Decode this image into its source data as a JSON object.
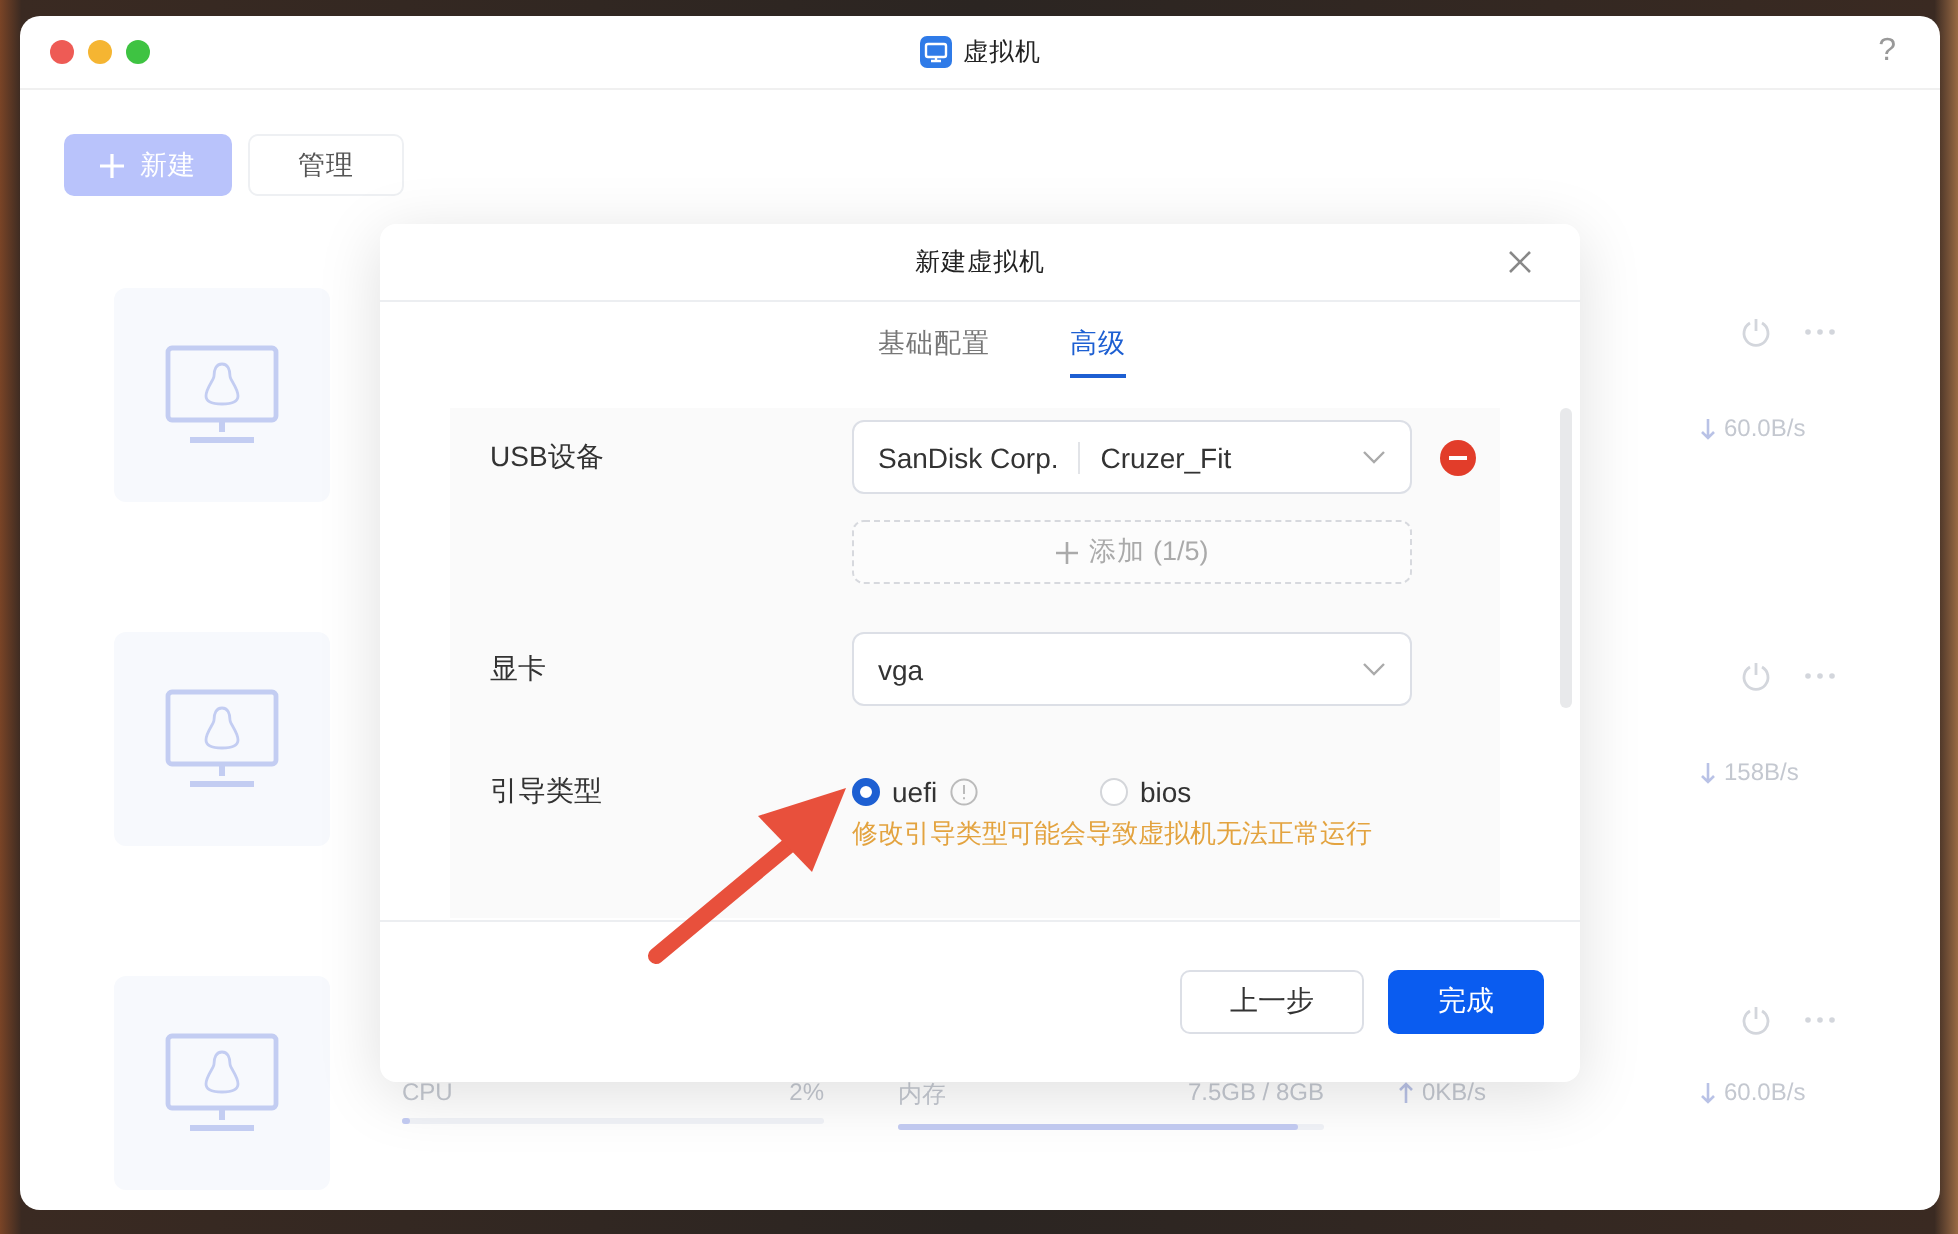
{
  "window": {
    "title": "虚拟机",
    "help": "?"
  },
  "toolbar": [
    {
      "label": "新建",
      "kind": "primary",
      "disabled": true
    },
    {
      "label": "管理",
      "kind": "default"
    }
  ],
  "vms": [
    {
      "download": "60.0B/s"
    },
    {
      "download": "158B/s"
    },
    {
      "stats": [
        {
          "label": "CPU",
          "value": "2%",
          "level": 0.02
        },
        {
          "label": "内存",
          "value": "7.5GB / 8GB",
          "level": 0.94
        }
      ],
      "upload": "0KB/s",
      "download": "60.0B/s"
    }
  ],
  "dialog": {
    "title": "新建虚拟机",
    "tabs": [
      {
        "label": "基础配置",
        "selected": false
      },
      {
        "label": "高级",
        "selected": true
      }
    ],
    "usb": {
      "label": "USB设备",
      "devices": [
        {
          "vendor": "SanDisk Corp.",
          "product": "Cruzer_Fit"
        }
      ],
      "add": "添加 (1/5)"
    },
    "gpu": {
      "label": "显卡",
      "value": "vga"
    },
    "boot": {
      "label": "引导类型",
      "options": [
        {
          "label": "uefi",
          "selected": true,
          "info": true
        },
        {
          "label": "bios",
          "selected": false
        }
      ],
      "warning": "修改引导类型可能会导致虚拟机无法正常运行"
    },
    "buttons": [
      {
        "label": "上一步",
        "kind": "default"
      },
      {
        "label": "完成",
        "kind": "primary"
      }
    ]
  }
}
